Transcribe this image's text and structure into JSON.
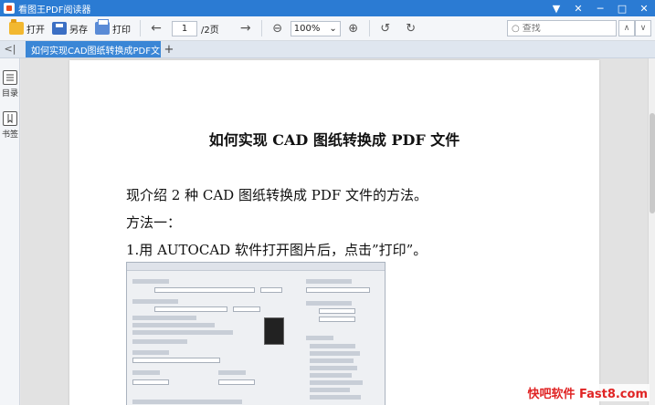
{
  "window": {
    "title": "看图王PDF阅读器",
    "controls": [
      "▼",
      "✕",
      "─",
      "□",
      "✕"
    ]
  },
  "toolbar": {
    "open_label": "打开",
    "saveas_label": "另存",
    "print_label": "打印",
    "prev_icon": "←",
    "next_icon": "→",
    "page_current": "1",
    "page_total": "/2页",
    "zoom_out_icon": "⊖",
    "zoom_value": "100%",
    "zoom_in_icon": "⊕",
    "rotate_left_icon": "↺",
    "rotate_right_icon": "↻",
    "search_placeholder": "查找",
    "search_prev": "∧",
    "search_next": "∨"
  },
  "tabs": {
    "collapse_icon": "<|",
    "items": [
      {
        "label": "如何实现CAD图纸转换成PDF文",
        "close": "×"
      }
    ],
    "new_tab": "+"
  },
  "sidebar": {
    "items": [
      {
        "label": "目录"
      },
      {
        "label": "书签"
      }
    ]
  },
  "document": {
    "title": "如何实现 CAD 图纸转换成 PDF 文件",
    "paragraphs": [
      "现介绍 2 种 CAD 图纸转换成 PDF 文件的方法。",
      "方法一：",
      "1.用 AUTOCAD 软件打开图片后，点击”打印”。"
    ]
  },
  "watermark": "快吧软件 Fast8.com"
}
